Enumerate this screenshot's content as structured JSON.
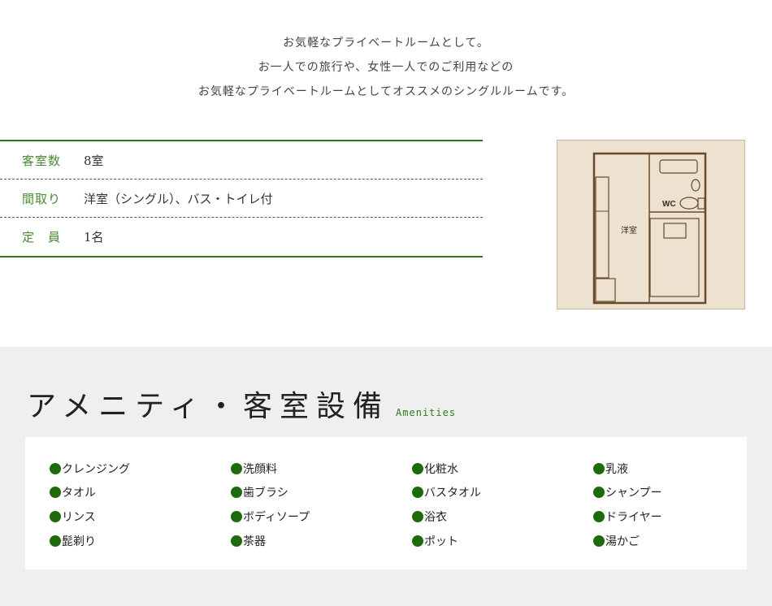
{
  "intro": {
    "line1": "お気軽なプライベートルームとして。",
    "line2": "お一人での旅行や、女性一人でのご利用などの",
    "line3": "お気軽なプライベートルームとしてオススメのシングルルームです。"
  },
  "spec": {
    "rows": [
      {
        "key": "客室数",
        "value": "8室"
      },
      {
        "key": "間取り",
        "value": "洋室（シングル）、バス・トイレ付"
      },
      {
        "key": "定　員",
        "value": "1名"
      }
    ]
  },
  "floorplan": {
    "room_label": "洋室",
    "wc_label": "WC"
  },
  "amenities": {
    "title": "アメニティ・客室設備",
    "subtitle": "Amenities",
    "items": [
      "クレンジング",
      "洗顔料",
      "化粧水",
      "乳液",
      "タオル",
      "歯ブラシ",
      "バスタオル",
      "シャンプー",
      "リンス",
      "ボディソープ",
      "浴衣",
      "ドライヤー",
      "髭剃り",
      "茶器",
      "ポット",
      "湯かご"
    ]
  },
  "colors": {
    "accent_green": "#2d7a1a",
    "bullet_green": "#1e6b0e",
    "floorplan_bg": "#ede1d0",
    "section_bg": "#efefef"
  }
}
